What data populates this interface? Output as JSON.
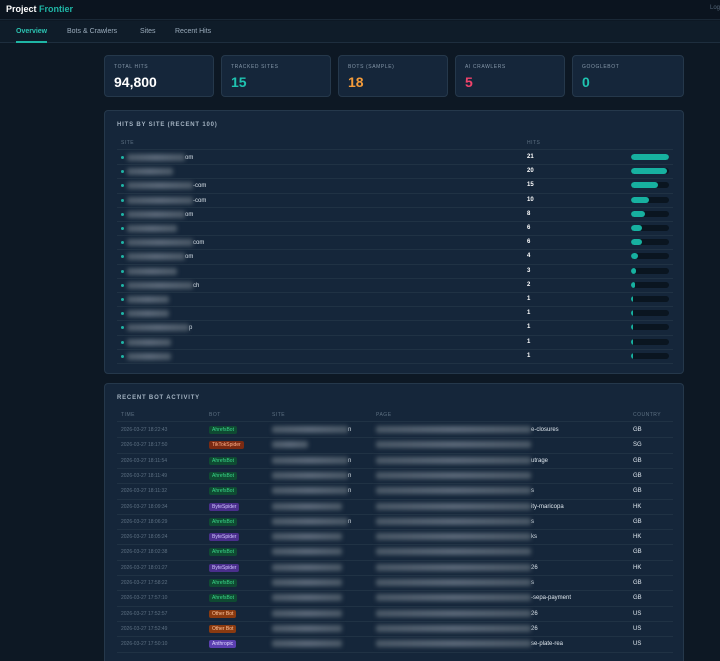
{
  "app": {
    "brand_main": "Project",
    "brand_accent": "Frontier",
    "top_right": "Log"
  },
  "nav": {
    "tabs": [
      "Overview",
      "Bots & Crawlers",
      "Sites",
      "Recent Hits"
    ],
    "active": 0
  },
  "stats": [
    {
      "label": "TOTAL HITS",
      "value": "94,800",
      "color": "#ffffff"
    },
    {
      "label": "TRACKED SITES",
      "value": "15",
      "color": "#1fc3b0"
    },
    {
      "label": "BOTS (SAMPLE)",
      "value": "18",
      "color": "#f39b3a"
    },
    {
      "label": "AI CRAWLERS",
      "value": "5",
      "color": "#f0436b"
    },
    {
      "label": "GOOGLEBOT",
      "value": "0",
      "color": "#1fc3b0"
    }
  ],
  "hits_by_site": {
    "title": "HITS BY SITE (RECENT 100)",
    "columns": [
      "SITE",
      "HITS"
    ],
    "max_hits": 21,
    "rows": [
      {
        "suffix": "om",
        "hits": 21
      },
      {
        "suffix": "",
        "hits": 20
      },
      {
        "suffix": "-com",
        "hits": 15
      },
      {
        "suffix": "-com",
        "hits": 10
      },
      {
        "suffix": "om",
        "hits": 8
      },
      {
        "suffix": "",
        "hits": 6
      },
      {
        "suffix": "com",
        "hits": 6
      },
      {
        "suffix": "om",
        "hits": 4
      },
      {
        "suffix": "",
        "hits": 3
      },
      {
        "suffix": "ch",
        "hits": 2
      },
      {
        "suffix": "",
        "hits": 1
      },
      {
        "suffix": "",
        "hits": 1
      },
      {
        "suffix": "p",
        "hits": 1
      },
      {
        "suffix": "",
        "hits": 1
      },
      {
        "suffix": "",
        "hits": 1
      }
    ]
  },
  "recent_activity": {
    "title": "RECENT BOT ACTIVITY",
    "columns": [
      "TIME",
      "BOT",
      "SITE",
      "PAGE",
      "COUNTRY"
    ],
    "rows": [
      {
        "time": "2026-03-27 18:22:43",
        "bot": "AhrefsBot",
        "badge": "ahrefs",
        "site_suffix": "n",
        "page_suffix": "e-closures",
        "country": "GB"
      },
      {
        "time": "2026-03-27 18:17:50",
        "bot": "TikTokSpider",
        "badge": "tiktok",
        "site_suffix": "",
        "page_suffix": "",
        "country": "SG"
      },
      {
        "time": "2026-03-27 18:11:54",
        "bot": "AhrefsBot",
        "badge": "ahrefs",
        "site_suffix": "n",
        "page_suffix": "utrage",
        "country": "GB"
      },
      {
        "time": "2026-03-27 18:11:49",
        "bot": "AhrefsBot",
        "badge": "ahrefs",
        "site_suffix": "n",
        "page_suffix": "",
        "country": "GB"
      },
      {
        "time": "2026-03-27 18:11:32",
        "bot": "AhrefsBot",
        "badge": "ahrefs",
        "site_suffix": "n",
        "page_suffix": "s",
        "country": "GB"
      },
      {
        "time": "2026-03-27 18:09:34",
        "bot": "ByteSpider",
        "badge": "bytes",
        "site_suffix": "",
        "page_suffix": "ity-maricopa",
        "country": "HK"
      },
      {
        "time": "2026-03-27 18:06:29",
        "bot": "AhrefsBot",
        "badge": "ahrefs",
        "site_suffix": "n",
        "page_suffix": "s",
        "country": "GB"
      },
      {
        "time": "2026-03-27 18:05:24",
        "bot": "ByteSpider",
        "badge": "bytes",
        "site_suffix": "",
        "page_suffix": "ks",
        "country": "HK"
      },
      {
        "time": "2026-03-27 18:02:38",
        "bot": "AhrefsBot",
        "badge": "ahrefs",
        "site_suffix": "",
        "page_suffix": "",
        "country": "GB"
      },
      {
        "time": "2026-03-27 18:01:27",
        "bot": "ByteSpider",
        "badge": "bytes",
        "site_suffix": "",
        "page_suffix": "26",
        "country": "HK"
      },
      {
        "time": "2026-03-27 17:58:22",
        "bot": "AhrefsBot",
        "badge": "ahrefs",
        "site_suffix": "",
        "page_suffix": "s",
        "country": "GB"
      },
      {
        "time": "2026-03-27 17:57:10",
        "bot": "AhrefsBot",
        "badge": "ahrefs",
        "site_suffix": "",
        "page_suffix": "-sepa-payment",
        "country": "GB"
      },
      {
        "time": "2026-03-27 17:52:57",
        "bot": "Other Bot",
        "badge": "other",
        "site_suffix": "",
        "page_suffix": "26",
        "country": "US"
      },
      {
        "time": "2026-03-27 17:52:49",
        "bot": "Other Bot",
        "badge": "other",
        "site_suffix": "",
        "page_suffix": "26",
        "country": "US"
      },
      {
        "time": "2026-03-27 17:50:10",
        "bot": "Anthropic",
        "badge": "anth",
        "site_suffix": "",
        "page_suffix": "se-plate-rea",
        "country": "US"
      }
    ]
  }
}
